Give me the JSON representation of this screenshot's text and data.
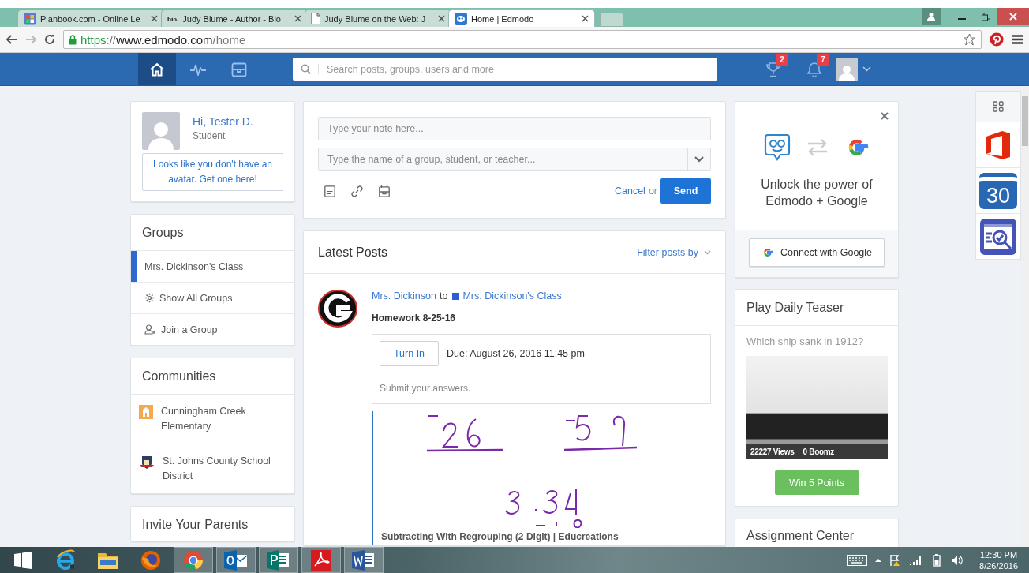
{
  "browser": {
    "tabs": [
      {
        "title": "Planbook.com - Online Le",
        "kind": "planbook",
        "selected": false
      },
      {
        "title": "Judy Blume - Author - Bio",
        "kind": "text",
        "favicon_text": "bio.",
        "selected": false
      },
      {
        "title": "Judy Blume on the Web: J",
        "kind": "document",
        "selected": false
      },
      {
        "title": "Home | Edmodo",
        "kind": "edmodo",
        "selected": true
      }
    ],
    "url": [
      {
        "kind": "scheme",
        "text": "https"
      },
      {
        "kind": "separator",
        "text": "://"
      },
      {
        "kind": "host",
        "text": "www.edmodo.com"
      },
      {
        "kind": "path",
        "text": "/home"
      }
    ]
  },
  "navbar": {
    "items": [
      {
        "kind": "home",
        "selected": true
      },
      {
        "kind": "activity",
        "selected": false
      },
      {
        "kind": "planner",
        "selected": false
      }
    ],
    "search": {
      "placeholder": "Search posts, groups, users and more"
    },
    "badges": [
      {
        "kind": "trophy",
        "count": "2"
      },
      {
        "kind": "bell",
        "count": "7"
      }
    ]
  },
  "profile": {
    "greeting": "Hi, Tester D.",
    "role": "Student",
    "avatar_prompt": "Looks like you don't have an avatar. Get one here!"
  },
  "groups": {
    "title": "Groups",
    "items": [
      {
        "label": "Mrs. Dickinson's Class",
        "kind": "group",
        "selected": true
      },
      {
        "label": "Show All Groups",
        "kind": "settings",
        "selected": false
      },
      {
        "label": "Join a Group",
        "kind": "join",
        "selected": false
      }
    ]
  },
  "communities": {
    "title": "Communities",
    "items": [
      {
        "name": "Cunningham Creek Elementary",
        "kind": "school"
      },
      {
        "name": "St. Johns County School District",
        "kind": "district"
      }
    ]
  },
  "invite": {
    "title": "Invite Your Parents"
  },
  "composer": {
    "note_placeholder": "Type your note here...",
    "recipient_placeholder": "Type the name of a group, student, or teacher...",
    "cancel": "Cancel",
    "or": "or",
    "send": "Send"
  },
  "posts": {
    "title": "Latest Posts",
    "filter": "Filter posts by",
    "items": [
      {
        "author": "Mrs. Dickinson",
        "to": "to",
        "group": "Mrs. Dickinson's Class",
        "title": "Homework 8-25-16",
        "turn_in": "Turn In",
        "due": "Due: August 26, 2016 11:45 pm",
        "instructions": "Submit your answers.",
        "attachment_title": "Subtracting With Regrouping (2 Digit) | Educreations"
      }
    ]
  },
  "google_promo": {
    "title": "Unlock the power of Edmodo + Google",
    "button": "Connect with Google"
  },
  "teaser": {
    "title": "Play Daily Teaser",
    "question": "Which ship sank in 1912?",
    "views": "22227 Views",
    "boomz": "0 Boomz",
    "button": "Win 5 Points"
  },
  "assignment_center": {
    "title": "Assignment Center"
  },
  "apps": [
    {
      "kind": "grid"
    },
    {
      "kind": "office"
    },
    {
      "kind": "calendar",
      "text": "30"
    },
    {
      "kind": "review"
    }
  ],
  "taskbar": {
    "apps": [
      {
        "kind": "ie",
        "running": false
      },
      {
        "kind": "explorer",
        "running": false
      },
      {
        "kind": "firefox",
        "running": false
      },
      {
        "kind": "chrome",
        "running": true
      },
      {
        "kind": "outlook",
        "running": true
      },
      {
        "kind": "publisher",
        "running": true
      },
      {
        "kind": "acrobat",
        "running": true
      },
      {
        "kind": "word",
        "running": true
      }
    ],
    "time": "12:30 PM",
    "date": "8/26/2016"
  }
}
